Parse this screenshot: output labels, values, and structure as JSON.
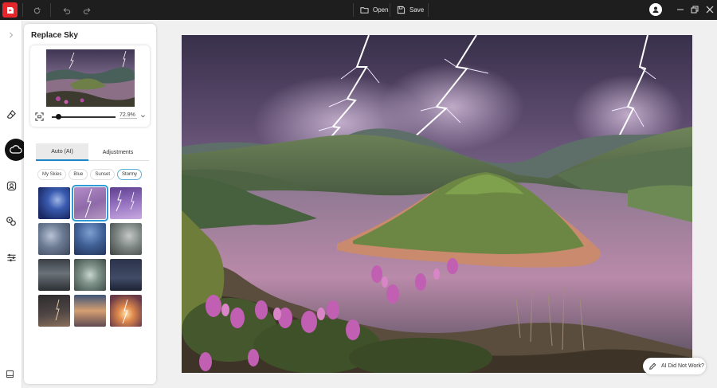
{
  "toolbar": {
    "open_label": "Open",
    "save_label": "Save"
  },
  "panel": {
    "title": "Replace Sky",
    "zoom_value": "72.9%",
    "tabs": [
      {
        "label": "Auto (AI)",
        "active": true
      },
      {
        "label": "Adjustments",
        "active": false
      }
    ],
    "chips": [
      {
        "label": "My Skies",
        "active": false
      },
      {
        "label": "Blue",
        "active": false
      },
      {
        "label": "Sunset",
        "active": false
      },
      {
        "label": "Stormy",
        "active": true
      }
    ]
  },
  "feedback": {
    "label": "AI Did Not Work?"
  },
  "colors": {
    "brand": "#e5262b",
    "accent": "#1e88c7",
    "topbar": "#1e1e1e"
  }
}
